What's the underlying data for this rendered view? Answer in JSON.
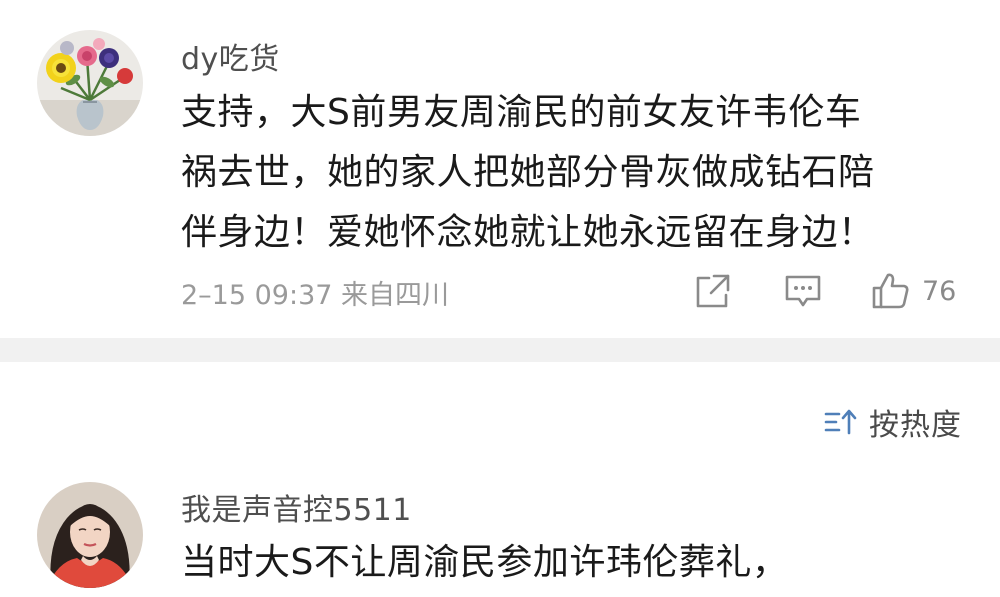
{
  "comments": [
    {
      "username": "dy吃货",
      "avatar": "flower-vase-icon",
      "lines": [
        "支持，大S前男友周渝民的前女友许韦伦车",
        "祸去世，她的家人把她部分骨灰做成钻石陪",
        "伴身边！爱她怀念她就让她永远留在身边！"
      ],
      "meta": "2–15 09:37 来自四川",
      "like_count": "76"
    },
    {
      "username": "我是声音控5511",
      "avatar": "portrait-woman-icon",
      "lines": [
        "当时大S不让周渝民参加许玮伦葬礼，"
      ]
    }
  ],
  "sort": {
    "label": "按热度",
    "icon": "sort-icon"
  },
  "colors": {
    "text_primary": "#1a1a1a",
    "text_username": "#4f4f4f",
    "text_meta": "#9a9a9a",
    "icon_gray": "#8a8a8a",
    "divider": "#f1f1f1"
  }
}
